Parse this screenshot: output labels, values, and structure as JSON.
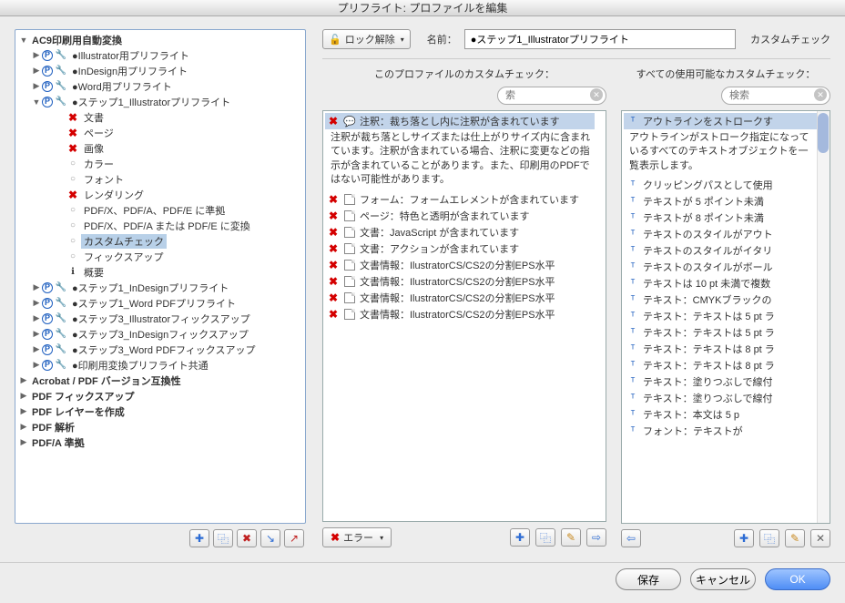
{
  "window": {
    "title": "プリフライト: プロファイルを編集"
  },
  "tree": {
    "root": "AC9印刷用自動変換",
    "nodes": [
      "●Illustrator用プリフライト",
      "●InDesign用プリフライト",
      "●Word用プリフライト",
      "●ステップ1_Illustratorプリフライト"
    ],
    "step1_children": [
      "文書",
      "ページ",
      "画像",
      "カラー",
      "フォント",
      "レンダリング",
      "PDF/X、PDF/A、PDF/E に準拠",
      "PDF/X、PDF/A または PDF/E に変換",
      "カスタムチェック",
      "フィックスアップ",
      "概要"
    ],
    "after": [
      "●ステップ1_InDesignプリフライト",
      "●ステップ1_Word PDFプリフライト",
      "●ステップ3_Illustratorフィックスアップ",
      "●ステップ3_InDesignフィックスアップ",
      "●ステップ3_Word PDFフィックスアップ",
      "●印刷用変換プリフライト共通"
    ],
    "bottom": [
      "Acrobat / PDF バージョン互換性",
      "PDF フィックスアップ",
      "PDF レイヤーを作成",
      "PDF 解析",
      "PDF/A 準拠"
    ]
  },
  "left_toolbar": {
    "b0": "✚",
    "b1": "⿻",
    "b2": "✖",
    "b3": "↘",
    "b4": "↗"
  },
  "top": {
    "lock": "ロック解除",
    "name_label": "名前：",
    "name_value": "●ステップ1_Illustratorプリフライト",
    "custom": "カスタムチェック"
  },
  "left_col": {
    "title": "このプロファイルのカスタムチェック：",
    "search_ph": "索",
    "sel": "注釈：裁ち落とし内に注釈が含まれています",
    "desc": "注釈が裁ち落としサイズまたは仕上がりサイズ内に含まれています。注釈が含まれている場合、注釈に変更などの指示が含まれていることがあります。また、印刷用のPDFではない可能性があります。",
    "items": [
      "フォーム：フォームエレメントが含まれています",
      "ページ：特色と透明が含まれています",
      "文書：JavaScript が含まれています",
      "文書：アクションが含まれています",
      "文書情報：IlustratorCS/CS2の分割EPS水平",
      "文書情報：IlustratorCS/CS2の分割EPS水平",
      "文書情報：IlustratorCS/CS2の分割EPS水平",
      "文書情報：IlustratorCS/CS2の分割EPS水平"
    ],
    "err_label": "エラー"
  },
  "right_col": {
    "title": "すべての使用可能なカスタムチェック：",
    "search_ph": "検索",
    "sel": "アウトラインをストロークす",
    "desc": "アウトラインがストローク指定になっているすべてのテキストオブジェクトを一覧表示します。",
    "items": [
      "クリッピングパスとして使用",
      "テキストが 5 ポイント未満",
      "テキストが 8 ポイント未満",
      "テキストのスタイルがアウト",
      "テキストのスタイルがイタリ",
      "テキストのスタイルがボール",
      "テキストは 10 pt 未満で複数",
      "テキスト：CMYKブラックの",
      "テキスト：テキストは 5 pt ラ",
      "テキスト：テキストは 5 pt ラ",
      "テキスト：テキストは 8 pt ラ",
      "テキスト：テキストは 8 pt ラ",
      "テキスト：塗りつぶしで線付",
      "テキスト：塗りつぶしで線付",
      "テキスト：本文は 5 p",
      "フォント：テキストが"
    ]
  },
  "footer": {
    "save": "保存",
    "cancel": "キャンセル",
    "ok": "OK"
  }
}
